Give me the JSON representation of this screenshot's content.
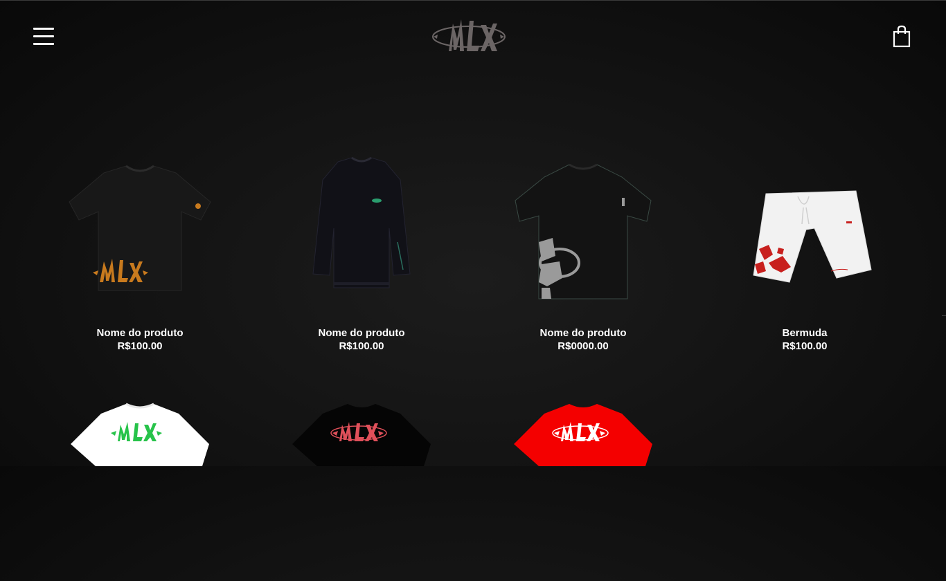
{
  "header": {
    "menu_icon": "hamburger-menu-icon",
    "logo_text": "MLX",
    "cart_icon": "shopping-bag-icon"
  },
  "products": [
    {
      "name": "Nome do produto",
      "price": "R$100.00",
      "image": "black-tshirt-orange-logo",
      "color": "#1a1a1a",
      "accent": "#c87a1e"
    },
    {
      "name": "Nome do produto",
      "price": "R$100.00",
      "image": "black-sweatshirt-green-badge",
      "color": "#121218",
      "accent": "#2a9d6e"
    },
    {
      "name": "Nome do produto",
      "price": "R$0000.00",
      "image": "black-tshirt-grey-logo",
      "color": "#141414",
      "accent": "#9a9a9a"
    },
    {
      "name": "Bermuda",
      "price": "R$100.00",
      "image": "white-shorts-red-logo",
      "color": "#f2f2f2",
      "accent": "#c8201e"
    },
    {
      "name": "",
      "price": "",
      "image": "white-tshirt-green-logo",
      "color": "#ffffff",
      "accent": "#27c34a"
    },
    {
      "name": "",
      "price": "",
      "image": "black-tshirt-red-logo",
      "color": "#050505",
      "accent": "#e0505a"
    },
    {
      "name": "",
      "price": "",
      "image": "red-tshirt-white-logo",
      "color": "#f40000",
      "accent": "#ffffff"
    }
  ]
}
